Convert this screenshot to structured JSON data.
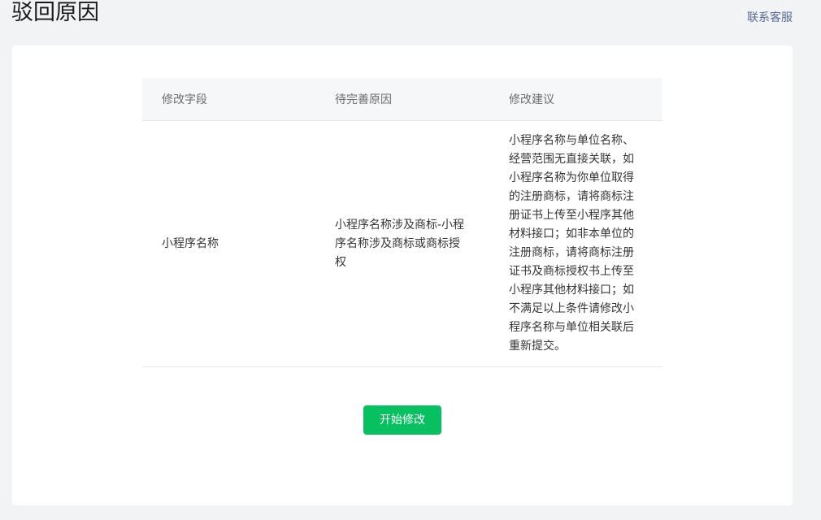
{
  "header": {
    "title": "驳回原因",
    "contact_link": "联系客服"
  },
  "table": {
    "columns": [
      "修改字段",
      "待完善原因",
      "修改建议"
    ],
    "rows": [
      {
        "field": "小程序名称",
        "reason": "小程序名称涉及商标-小程序名称涉及商标或商标授权",
        "suggestion": "小程序名称与单位名称、经营范围无直接关联，如小程序名称为你单位取得的注册商标，请将商标注册证书上传至小程序其他材料接口；如非本单位的注册商标，请将商标注册证书及商标授权书上传至小程序其他材料接口；如不满足以上条件请修改小程序名称与单位相关联后重新提交。"
      }
    ]
  },
  "actions": {
    "start_edit_label": "开始修改"
  },
  "colors": {
    "primary": "#07c160",
    "link": "#576b95",
    "background": "#f2f3f5"
  }
}
